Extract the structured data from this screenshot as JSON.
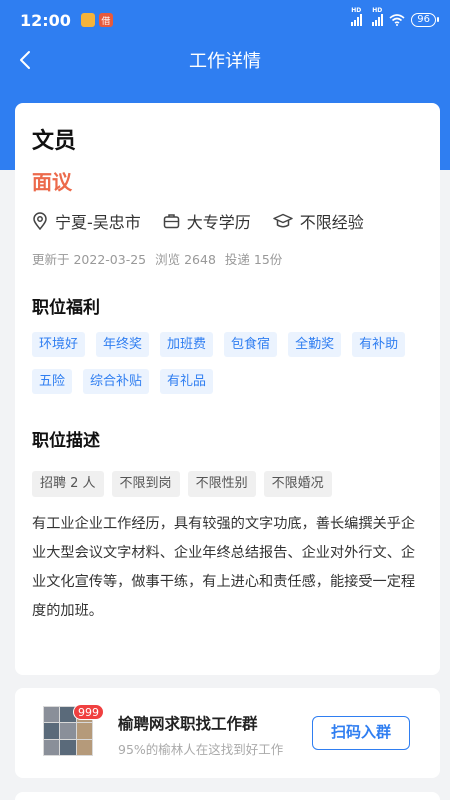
{
  "status_bar": {
    "time": "12:00",
    "battery": "96",
    "hd1": "HD",
    "hd2": "HD",
    "notif_b": "借"
  },
  "nav": {
    "title": "工作详情"
  },
  "job": {
    "title": "文员",
    "salary": "面议",
    "location": "宁夏-吴忠市",
    "education": "大专学历",
    "experience": "不限经验",
    "updated": "更新于 2022-03-25",
    "views": "浏览 2648",
    "applications": "投递 15份"
  },
  "benefits": {
    "heading": "职位福利",
    "items": [
      "环境好",
      "年终奖",
      "加班费",
      "包食宿",
      "全勤奖",
      "有补助",
      "五险",
      "综合补贴",
      "有礼品"
    ]
  },
  "description": {
    "heading": "职位描述",
    "requirements": [
      "招聘 2 人",
      "不限到岗",
      "不限性别",
      "不限婚况"
    ],
    "text": "有工业企业工作经历，具有较强的文字功底，善长编撰关乎企业大型会议文字材料、企业年终总结报告、企业对外行文、企业文化宣传等，做事干练，有上进心和责任感，能接受一定程度的加班。"
  },
  "ad": {
    "badge": "999",
    "title": "榆聘网求职找工作群",
    "subtitle": "95%的榆林人在这找到好工作",
    "button": "扫码入群"
  },
  "colors": {
    "primary": "#2f7ef1",
    "salary": "#ec6a4b"
  }
}
